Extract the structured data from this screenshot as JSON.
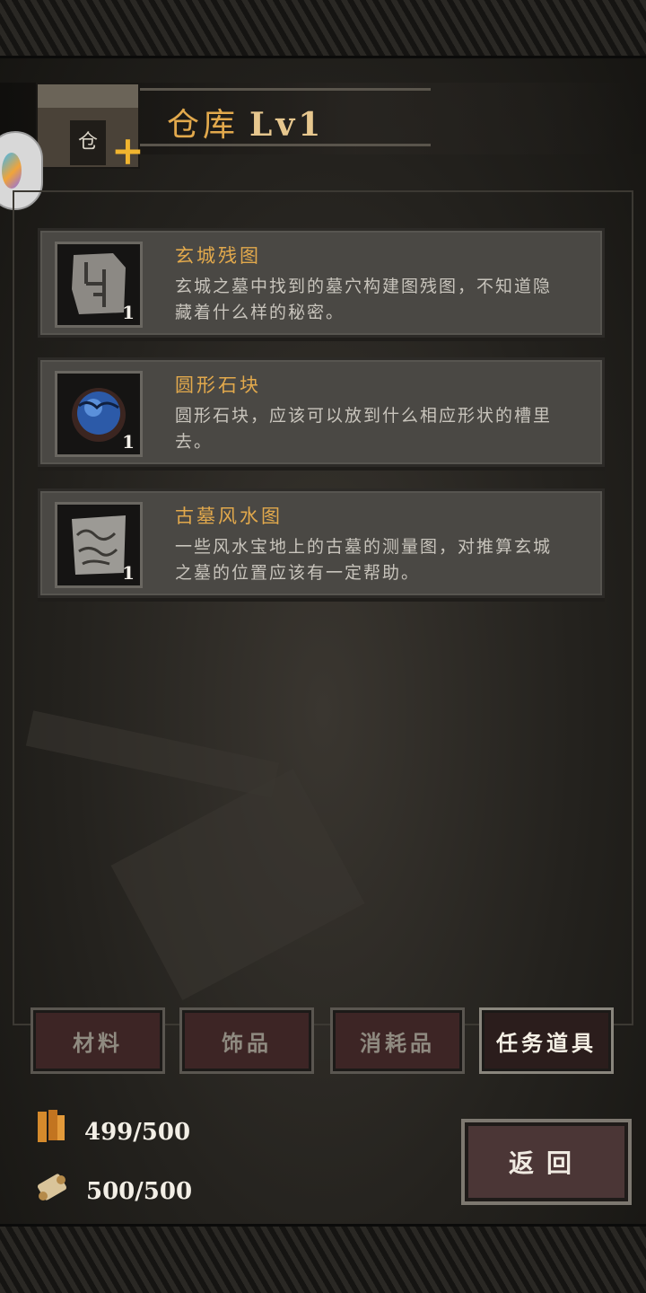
{
  "header": {
    "title": "仓库",
    "level": "Lv1"
  },
  "items": [
    {
      "name": "玄城残图",
      "description": "玄城之墓中找到的墓穴构建图残图，不知道隐藏着什么样的秘密。",
      "count": "1",
      "icon": "map-fragment-icon"
    },
    {
      "name": "圆形石块",
      "description": "圆形石块，应该可以放到什么相应形状的槽里去。",
      "count": "1",
      "icon": "round-stone-icon"
    },
    {
      "name": "古墓风水图",
      "description": "一些风水宝地上的古墓的测量图，对推算玄城之墓的位置应该有一定帮助。",
      "count": "1",
      "icon": "fengshui-map-icon"
    }
  ],
  "tabs": [
    {
      "label": "材料",
      "active": false
    },
    {
      "label": "饰品",
      "active": false
    },
    {
      "label": "消耗品",
      "active": false
    },
    {
      "label": "任务道具",
      "active": true
    }
  ],
  "resources": [
    {
      "value": "499/500",
      "icon": "wood-icon"
    },
    {
      "value": "500/500",
      "icon": "scroll-icon"
    }
  ],
  "back_label": "返回",
  "colors": {
    "title": "#e2a94c",
    "item_name": "#e2a94c",
    "plus": "#f1b52f",
    "tab_bg": "#3d2525"
  }
}
